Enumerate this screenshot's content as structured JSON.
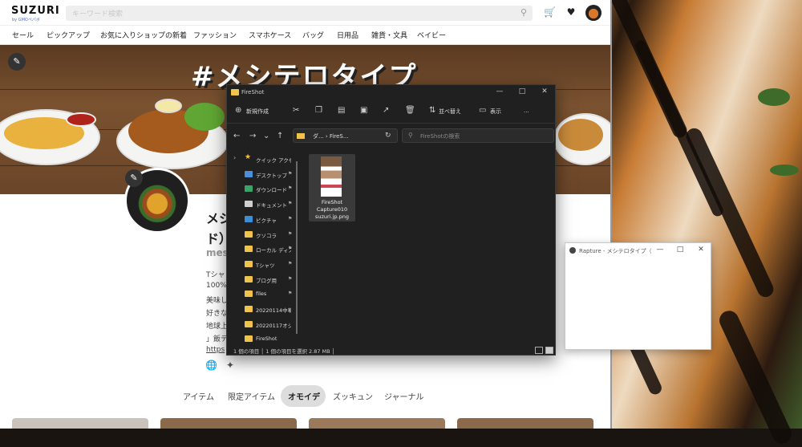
{
  "browser": {
    "logo": "SUZURI",
    "logo_sub": "by GMOペパボ",
    "search_placeholder": "キーワード検索",
    "categories": [
      "セール",
      "ピックアップ",
      "お気に入りショップの新着",
      "ファッション",
      "スマホケース",
      "バッグ",
      "日用品",
      "雑貨・文具",
      "ベイビー"
    ],
    "banner_title": "#メシテロタイプ",
    "shop_name_line1": "メシ",
    "shop_name_line2": "ド）",
    "shop_id": "mes",
    "description": [
      "Tシャ",
      "100%",
      "美味し",
      "好きな",
      "地球上",
      "」飯テ"
    ],
    "link": "https",
    "tabs": [
      "アイテム",
      "限定アイテム",
      "オモイデ",
      "ズッキュン",
      "ジャーナル"
    ]
  },
  "explorer": {
    "title": "FireShot",
    "toolbar": {
      "new_label": "新規作成",
      "sort_label": "並べ替え",
      "view_label": "表示",
      "more": "..."
    },
    "address": "ダ... › FireS...",
    "search_placeholder": "FireShotの検索",
    "nav_items": [
      {
        "label": "クイック アクセス",
        "icon": "star-icon",
        "color": "#f5c342",
        "pinned": false
      },
      {
        "label": "デスクトップ",
        "icon": "desktop-icon",
        "color": "#4a90d9",
        "pinned": true
      },
      {
        "label": "ダウンロード",
        "icon": "download-icon",
        "color": "#3aa36a",
        "pinned": true
      },
      {
        "label": "ドキュメント",
        "icon": "document-icon",
        "color": "#cfcfcf",
        "pinned": true
      },
      {
        "label": "ピクチャ",
        "icon": "picture-icon",
        "color": "#3a8fd9",
        "pinned": true
      },
      {
        "label": "クソコラ",
        "icon": "folder-icon",
        "color": "#f0c44c",
        "pinned": true
      },
      {
        "label": "ローカル ディス",
        "icon": "folder-icon",
        "color": "#f0c44c",
        "pinned": true
      },
      {
        "label": "Tシャツ",
        "icon": "folder-icon",
        "color": "#f0c44c",
        "pinned": true
      },
      {
        "label": "ブログ用",
        "icon": "folder-icon",
        "color": "#f0c44c",
        "pinned": true
      },
      {
        "label": "files",
        "icon": "folder-icon",
        "color": "#f0c44c",
        "pinned": true
      },
      {
        "label": "20220114中華モ",
        "icon": "folder-icon",
        "color": "#f0c44c",
        "pinned": false
      },
      {
        "label": "20220117オシズ",
        "icon": "folder-icon",
        "color": "#f0c44c",
        "pinned": false
      },
      {
        "label": "FireShot",
        "icon": "folder-icon",
        "color": "#f0c44c",
        "pinned": false
      }
    ],
    "file": {
      "name_line1": "FireShot",
      "name_line2": "Capture010",
      "name_line3": "suzuri.jp.png"
    },
    "status": "1 個の項目 │ 1 個の項目を選択 2.87 MB │"
  },
  "rapture": {
    "title": "Rapture - メシテロタイプ（..."
  }
}
